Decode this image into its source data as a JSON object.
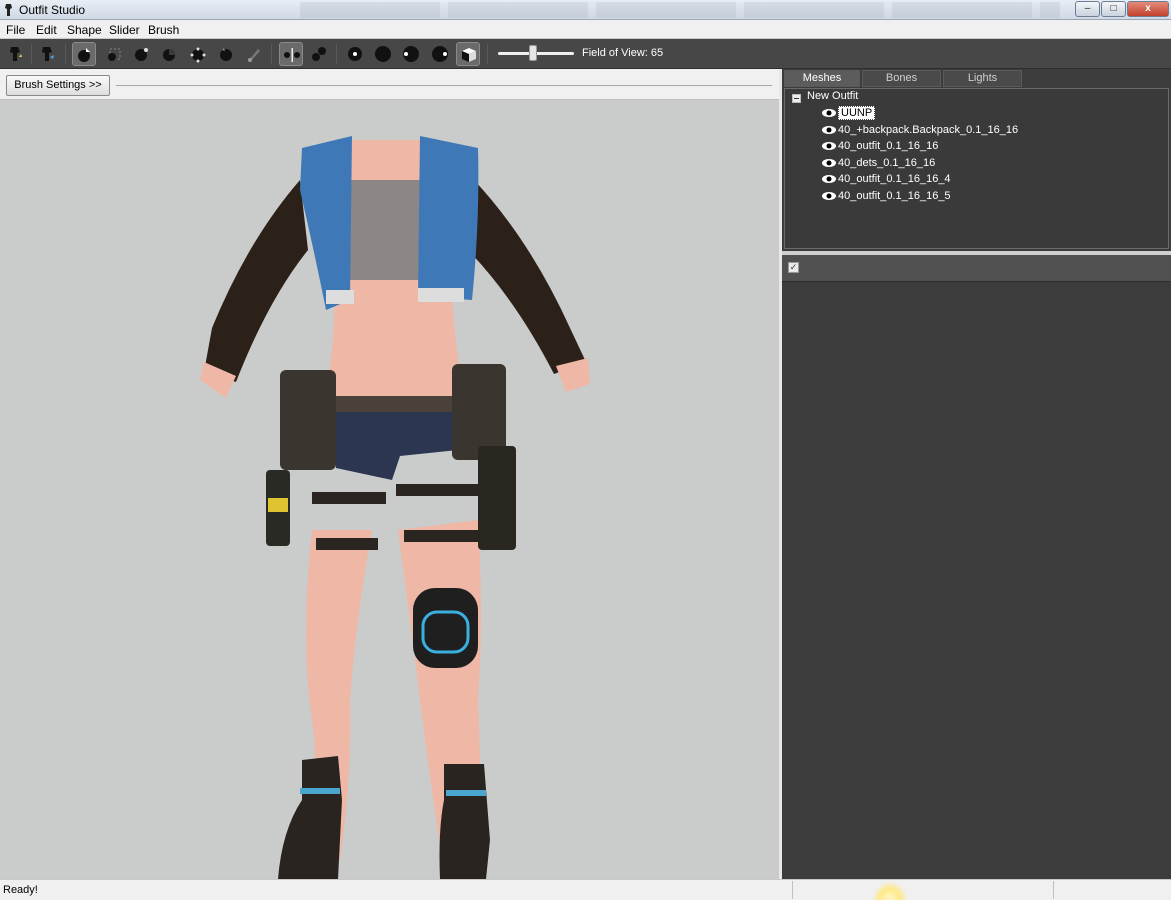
{
  "window": {
    "title": "Outfit Studio",
    "controls": {
      "minimize": "–",
      "maximize": "□",
      "close": "x"
    }
  },
  "menubar": {
    "items": [
      "File",
      "Edit",
      "Shape",
      "Slider",
      "Brush"
    ]
  },
  "toolbar": {
    "field_of_view_label": "Field of View: 65",
    "field_of_view_level": 0.42,
    "icons": [
      "select-brush-icon",
      "transform-icon",
      "move-brush-icon",
      "mask-brush-icon",
      "inflate-brush-icon",
      "deflate-brush-icon",
      "smooth-brush-icon",
      "undiff-brush-icon",
      "weight-brush-icon",
      "color-brush-icon",
      "mirror-x-icon",
      "connected-icon",
      "brush-size-1-icon",
      "brush-size-2-icon",
      "brush-size-3-icon",
      "brush-size-4-icon",
      "cube-view-icon"
    ]
  },
  "brush_panel": {
    "button_label": "Brush Settings >>"
  },
  "right_panel": {
    "tabs": [
      "Meshes",
      "Bones",
      "Lights"
    ],
    "active_tab": "Meshes",
    "tree": {
      "root": "New Outfit",
      "items": [
        {
          "label": "UUNP",
          "selected": true,
          "visible": true
        },
        {
          "label": "40_+backpack.Backpack_0.1_16_16",
          "selected": false,
          "visible": true
        },
        {
          "label": "40_outfit_0.1_16_16",
          "selected": false,
          "visible": true
        },
        {
          "label": "40_dets_0.1_16_16",
          "selected": false,
          "visible": true
        },
        {
          "label": "40_outfit_0.1_16_16_4",
          "selected": false,
          "visible": true
        },
        {
          "label": "40_outfit_0.1_16_16_5",
          "selected": false,
          "visible": true
        }
      ]
    },
    "slider_checkbox": "✓"
  },
  "status": {
    "text": "Ready!"
  },
  "colors": {
    "toolbar_bg": "#474747",
    "panel_bg": "#3c3c3c",
    "viewport_bg": "#c9cccb",
    "jacket_blue": "#3f78b7",
    "sleeve_brown": "#2b2119",
    "skin": "#efb8a6"
  }
}
